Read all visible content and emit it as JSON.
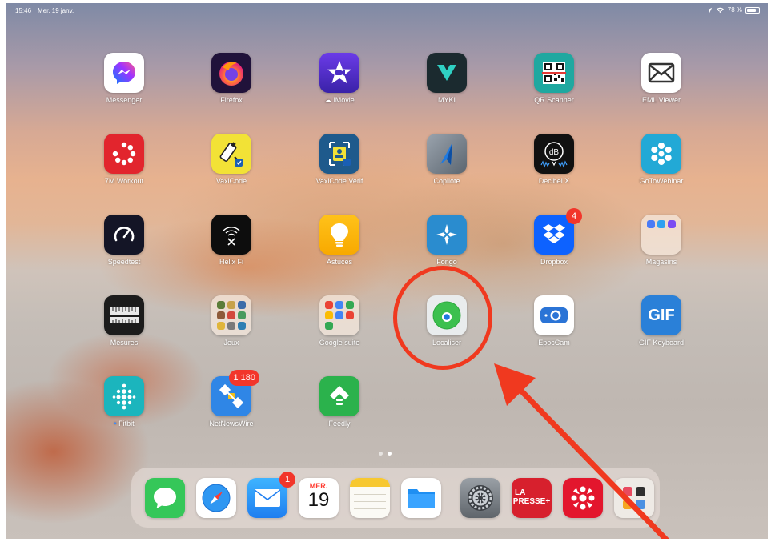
{
  "status_bar": {
    "time": "15:46",
    "date": "Mer. 19 janv.",
    "battery": "78 %",
    "battery_level": 0.78
  },
  "apps": {
    "messenger": {
      "label": "Messenger",
      "color": "#ffffff"
    },
    "firefox": {
      "label": "Firefox"
    },
    "imovie": {
      "label": "iMovie"
    },
    "myki": {
      "label": "MYKI"
    },
    "qr_scanner": {
      "label": "QR Scanner"
    },
    "eml_viewer": {
      "label": "EML Viewer"
    },
    "workout7m": {
      "label": "7M Workout"
    },
    "vaxicode": {
      "label": "VaxiCode"
    },
    "vaxicode_verif": {
      "label": "VaxiCode Verif"
    },
    "copilote": {
      "label": "Copilote"
    },
    "decibel_x": {
      "label": "Decibel X",
      "glyph": "dB"
    },
    "gotowebinar": {
      "label": "GoToWebinar"
    },
    "speedtest": {
      "label": "Speedtest"
    },
    "helix_fi": {
      "label": "Helix Fi"
    },
    "astuces": {
      "label": "Astuces"
    },
    "fongo": {
      "label": "Fongo"
    },
    "dropbox": {
      "label": "Dropbox",
      "badge": "4"
    },
    "magasins": {
      "label": "Magasins"
    },
    "mesures": {
      "label": "Mesures"
    },
    "jeux": {
      "label": "Jeux"
    },
    "google_suite": {
      "label": "Google suite"
    },
    "localiser": {
      "label": "Localiser"
    },
    "epoccam": {
      "label": "EpocCam"
    },
    "gif_keyboard": {
      "label": "GIF Keyboard",
      "glyph": "GIF"
    },
    "fitbit": {
      "label": "Fitbit"
    },
    "netnewswire": {
      "label": "NetNewsWire",
      "badge": "1 180"
    },
    "feedly": {
      "label": "Feedly"
    }
  },
  "dock": {
    "mail_badge": "1",
    "calendar_month": "MER.",
    "calendar_day": "19",
    "lapresse_line1": "LA",
    "lapresse_line2": "PRESSE+"
  },
  "page_dots": {
    "count": 2,
    "active": 1
  },
  "annotation": {
    "color": "#f0391f",
    "target": "Localiser"
  }
}
